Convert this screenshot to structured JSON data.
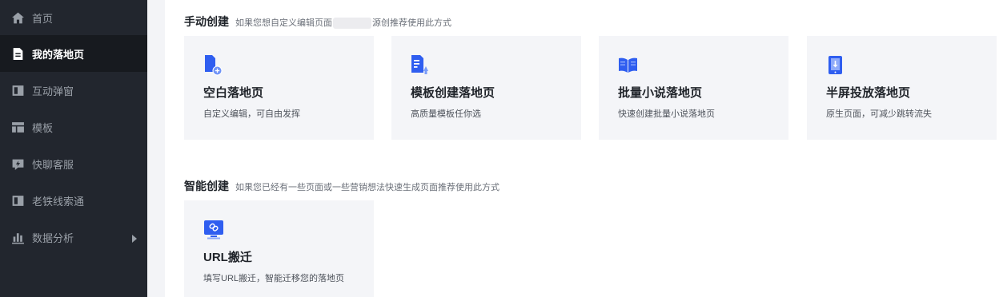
{
  "sidebar": {
    "items": [
      {
        "label": "首页",
        "icon": "home-icon"
      },
      {
        "label": "我的落地页",
        "icon": "document-icon"
      },
      {
        "label": "互动弹窗",
        "icon": "popup-icon"
      },
      {
        "label": "模板",
        "icon": "template-icon"
      },
      {
        "label": "快聊客服",
        "icon": "chat-icon"
      },
      {
        "label": "老铁线索通",
        "icon": "leads-icon"
      },
      {
        "label": "数据分析",
        "icon": "bar-chart-icon"
      }
    ]
  },
  "manual": {
    "title": "手动创建",
    "desc_before": "如果您想自定义编辑页面",
    "desc_after": "源创推荐使用此方式"
  },
  "smart": {
    "title": "智能创建",
    "desc": "如果您已经有一些页面或一些营销想法快速生成页面推荐使用此方式"
  },
  "cards": [
    {
      "title": "空白落地页",
      "desc": "自定义编辑，可自由发挥",
      "icon": "blank-page-icon"
    },
    {
      "title": "模板创建落地页",
      "desc": "高质量模板任你选",
      "icon": "template-page-icon"
    },
    {
      "title": "批量小说落地页",
      "desc": "快速创建批量小说落地页",
      "icon": "book-icon"
    },
    {
      "title": "半屏投放落地页",
      "desc": "原生页面，可减少跳转流失",
      "icon": "half-screen-icon"
    },
    {
      "title": "URL搬迁",
      "desc": "填写URL搬迁，智能迁移您的落地页",
      "icon": "link-monitor-icon"
    }
  ],
  "colors": {
    "sidebar_bg": "#22262e",
    "sidebar_active_bg": "#171a1f",
    "accent": "#3c6cf5",
    "card_bg": "#f4f5f8"
  }
}
